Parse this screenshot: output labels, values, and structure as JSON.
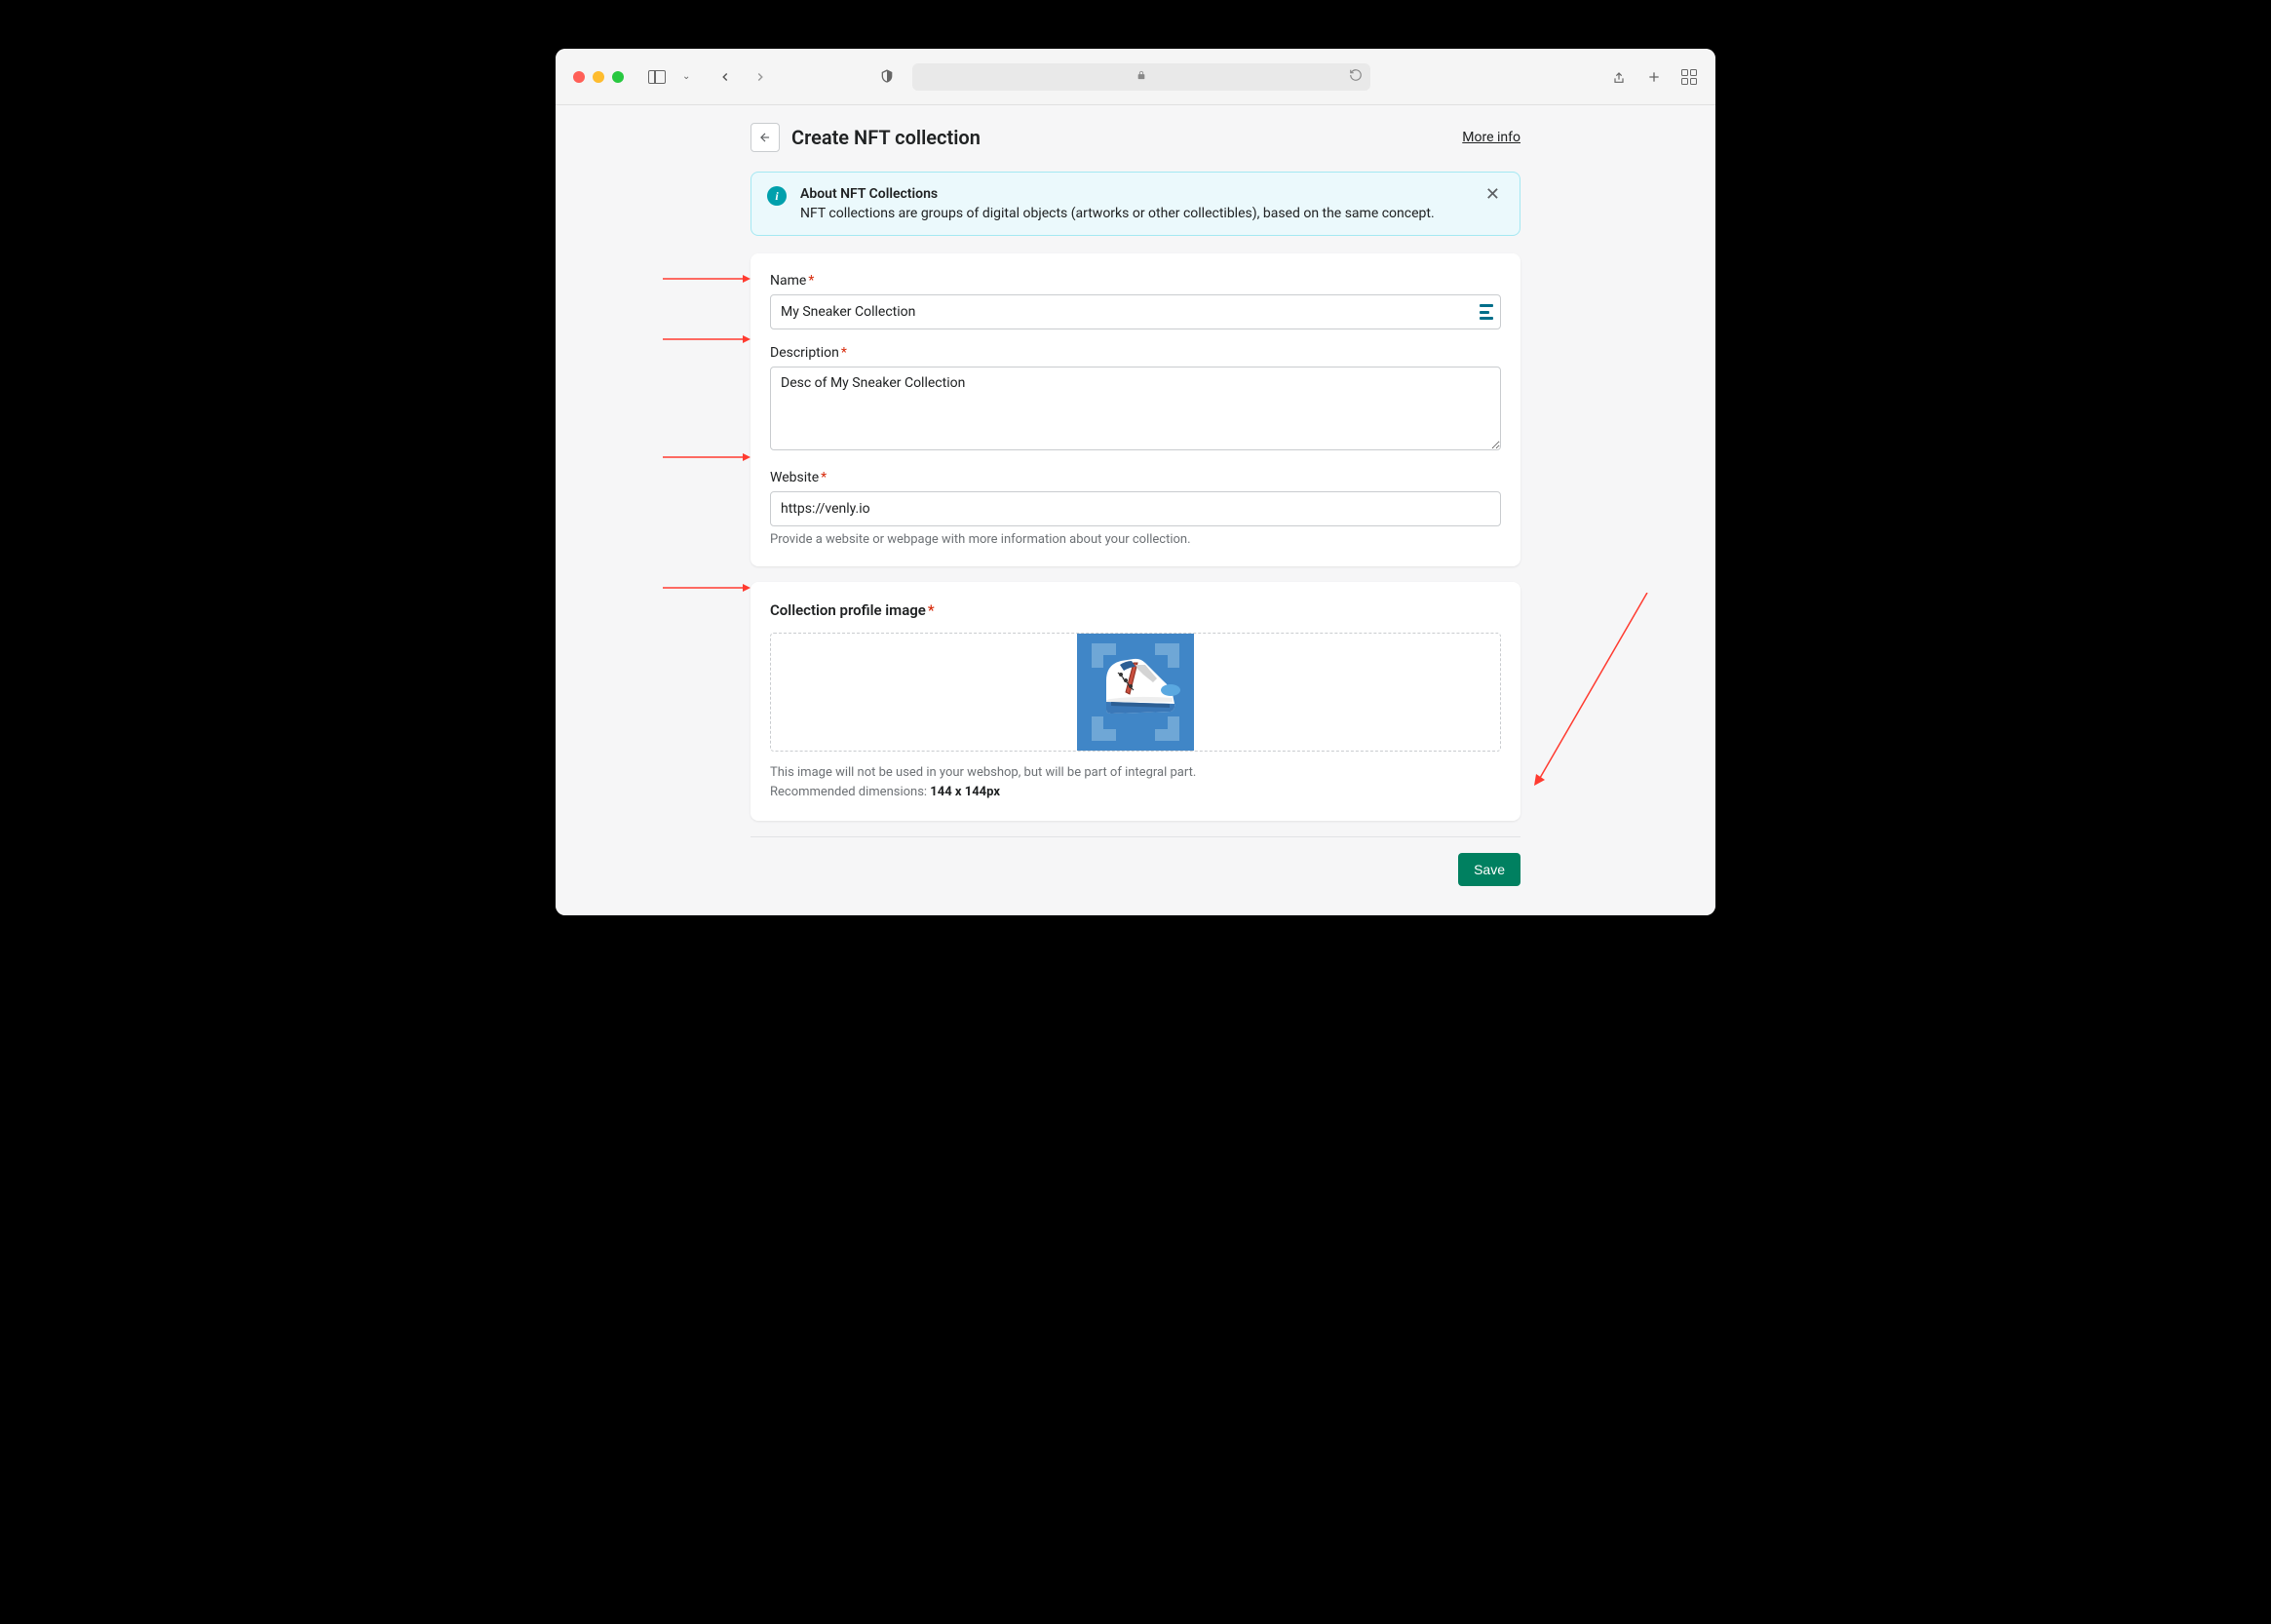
{
  "page": {
    "title": "Create NFT collection",
    "more_info_label": "More info"
  },
  "banner": {
    "title": "About NFT Collections",
    "description": "NFT collections are groups of digital objects (artworks or other collectibles), based on the same concept."
  },
  "form": {
    "name": {
      "label": "Name",
      "value": "My Sneaker Collection"
    },
    "description": {
      "label": "Description",
      "value": "Desc of My Sneaker Collection"
    },
    "website": {
      "label": "Website",
      "value": "https://venly.io",
      "help": "Provide a website or webpage with more information about your collection."
    },
    "profile_image": {
      "label": "Collection profile image",
      "help_line1": "This image will not be used in your webshop, but will be part of integral part.",
      "help_line2_prefix": "Recommended dimensions: ",
      "help_line2_bold": "144 x 144px"
    }
  },
  "actions": {
    "save": "Save"
  }
}
